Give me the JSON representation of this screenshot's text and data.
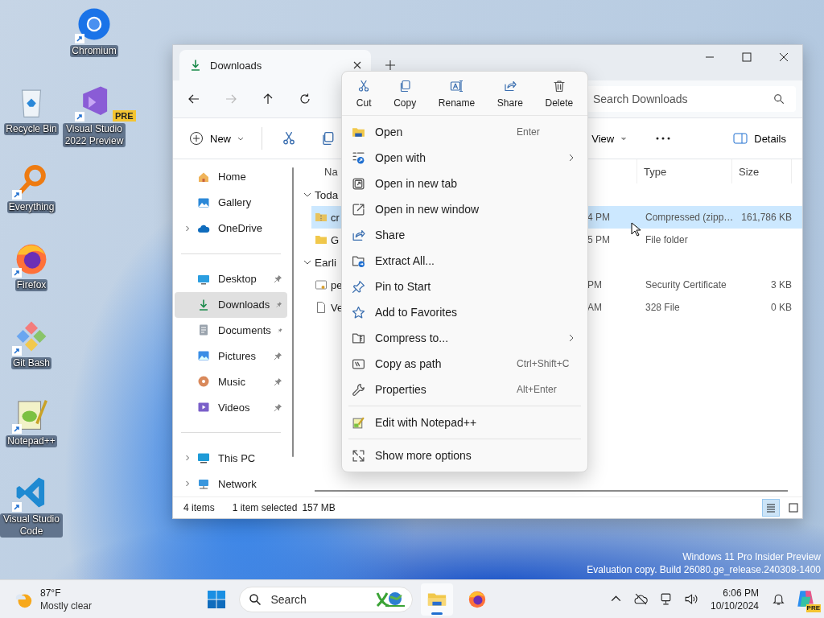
{
  "desktop": {
    "columns": [
      [
        {
          "kind": "bin",
          "label": "Recycle Bin",
          "shortcut": false
        },
        {
          "kind": "everything",
          "label": "Everything",
          "shortcut": true
        },
        {
          "kind": "fox",
          "label": "Firefox",
          "shortcut": true
        },
        {
          "kind": "git",
          "label": "Git Bash",
          "shortcut": true
        },
        {
          "kind": "notepad",
          "label": "Notepad++",
          "shortcut": true
        },
        {
          "kind": "code",
          "label": "Visual Studio Code",
          "shortcut": true
        }
      ],
      [
        {
          "kind": "chrome",
          "label": "Chromium",
          "shortcut": true
        },
        {
          "kind": "vs",
          "label": "Visual Studio 2022 Preview",
          "shortcut": true,
          "badge": "PRE"
        }
      ]
    ]
  },
  "window": {
    "tab": {
      "title": "Downloads"
    },
    "navigation": {
      "forward_disabled": true
    },
    "search": {
      "placeholder": "Search Downloads"
    },
    "command_bar": {
      "new": "New",
      "view": "View",
      "details": "Details"
    },
    "sidebar": {
      "groups": [
        [
          {
            "kind": "home",
            "label": "Home",
            "expandable": false,
            "pinned": false,
            "selected": false
          },
          {
            "kind": "gallery",
            "label": "Gallery",
            "expandable": false,
            "pinned": false,
            "selected": false
          },
          {
            "kind": "cloud",
            "label": "OneDrive",
            "expandable": true,
            "pinned": false,
            "selected": false
          }
        ],
        [
          {
            "kind": "desktop",
            "label": "Desktop",
            "expandable": false,
            "pinned": true,
            "selected": false
          },
          {
            "kind": "download",
            "label": "Downloads",
            "expandable": false,
            "pinned": true,
            "selected": true
          },
          {
            "kind": "documents",
            "label": "Documents",
            "expandable": false,
            "pinned": true,
            "selected": false
          },
          {
            "kind": "pictures",
            "label": "Pictures",
            "expandable": false,
            "pinned": true,
            "selected": false
          },
          {
            "kind": "music",
            "label": "Music",
            "expandable": false,
            "pinned": true,
            "selected": false
          },
          {
            "kind": "videos",
            "label": "Videos",
            "expandable": false,
            "pinned": true,
            "selected": false
          }
        ],
        [
          {
            "kind": "pc",
            "label": "This PC",
            "expandable": true,
            "pinned": false,
            "selected": false
          },
          {
            "kind": "network",
            "label": "Network",
            "expandable": true,
            "pinned": false,
            "selected": false
          }
        ]
      ]
    },
    "file_list": {
      "columns": {
        "name": "Na",
        "type": "Type",
        "size": "Size"
      },
      "groups": [
        {
          "label": "Toda",
          "expanded": true,
          "rows": [
            {
              "kind": "zip",
              "name": "cr",
              "date": "4 PM",
              "type": "Compressed (zipp…",
              "size": "161,786 KB",
              "selected": true
            },
            {
              "kind": "folder",
              "name": "G",
              "date": "5 PM",
              "type": "File folder",
              "selected": false
            }
          ]
        },
        {
          "label": "Earli",
          "expanded": true,
          "rows": [
            {
              "kind": "cert",
              "name": "pe",
              "date": "PM",
              "type": "Security Certificate",
              "size": "3 KB",
              "selected": false
            },
            {
              "kind": "file",
              "name": "Ve",
              "date": "AM",
              "type": "328 File",
              "size": "0 KB",
              "selected": false
            }
          ]
        }
      ]
    },
    "status_bar": {
      "count": "4 items",
      "selection": "1 item selected",
      "size": "157 MB",
      "view_buttons": [
        {
          "kind": "details",
          "selected": true
        },
        {
          "kind": "tiles",
          "selected": false
        }
      ]
    }
  },
  "context_menu": {
    "actions": [
      {
        "kind": "cut",
        "label": "Cut"
      },
      {
        "kind": "copy",
        "label": "Copy"
      },
      {
        "kind": "rename",
        "label": "Rename"
      },
      {
        "kind": "share",
        "label": "Share"
      },
      {
        "kind": "delete",
        "label": "Delete"
      }
    ],
    "sections": [
      [
        {
          "kind": "open",
          "label": "Open",
          "shortcut": "Enter",
          "submenu": false
        },
        {
          "kind": "open-with",
          "label": "Open with",
          "submenu": true
        },
        {
          "kind": "new-tab",
          "label": "Open in new tab",
          "submenu": false
        },
        {
          "kind": "new-window",
          "label": "Open in new window",
          "submenu": false
        },
        {
          "kind": "share",
          "label": "Share",
          "submenu": false
        },
        {
          "kind": "extract",
          "label": "Extract All...",
          "submenu": false
        },
        {
          "kind": "pin",
          "label": "Pin to Start",
          "submenu": false
        },
        {
          "kind": "favorite",
          "label": "Add to Favorites",
          "submenu": false
        },
        {
          "kind": "compress",
          "label": "Compress to...",
          "submenu": true
        },
        {
          "kind": "copy-path",
          "label": "Copy as path",
          "shortcut": "Ctrl+Shift+C",
          "submenu": false
        },
        {
          "kind": "properties",
          "label": "Properties",
          "shortcut": "Alt+Enter",
          "submenu": false
        }
      ],
      [
        {
          "kind": "notepad",
          "label": "Edit with Notepad++",
          "submenu": false
        }
      ],
      [
        {
          "kind": "more",
          "label": "Show more options",
          "submenu": false
        }
      ]
    ]
  },
  "system_notice": [
    "Windows 11 Pro Insider Preview",
    "Evaluation copy. Build 26080.ge_release.240308-1400"
  ],
  "taskbar": {
    "weather": {
      "temperature": "87°F",
      "condition": "Mostly clear"
    },
    "search": {
      "placeholder": "Search"
    },
    "apps": [
      {
        "kind": "explorer",
        "active": true
      },
      {
        "kind": "fox",
        "active": false
      }
    ],
    "clock": {
      "time": "6:06 PM",
      "date": "10/10/2024"
    },
    "copilot_badge": "PRE"
  }
}
